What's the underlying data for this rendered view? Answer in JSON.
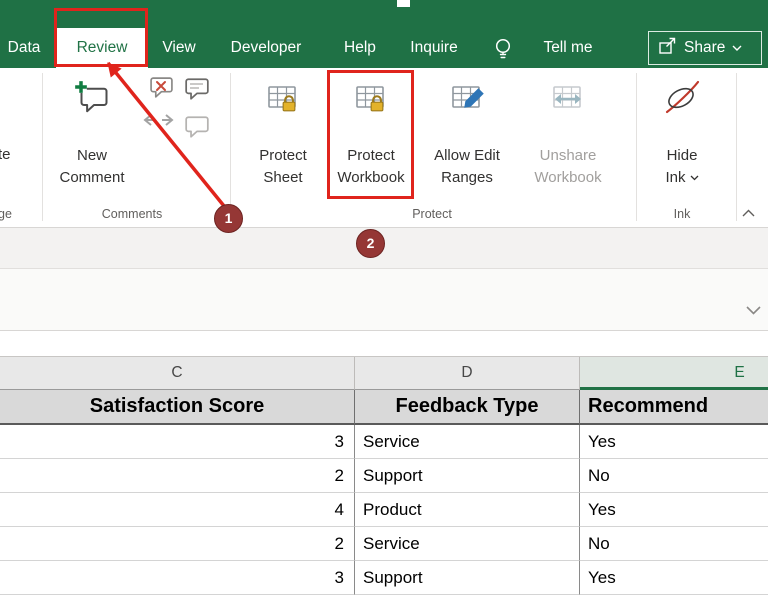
{
  "colors": {
    "excel_green": "#217346",
    "selected_tab_text": "#217346",
    "annotation_red": "#e0241c",
    "step_badge_red": "#953735",
    "table_header_fill": "#d9d9d9",
    "column_header_fill": "#e8e8e8"
  },
  "ribbon": {
    "tabs": [
      {
        "label": "Data",
        "selected": false
      },
      {
        "label": "Review",
        "selected": true
      },
      {
        "label": "View",
        "selected": false
      },
      {
        "label": "Developer",
        "selected": false
      },
      {
        "label": "Help",
        "selected": false
      },
      {
        "label": "Inquire",
        "selected": false
      }
    ],
    "tell_me_label": "Tell me",
    "share_label": "Share",
    "edge_fragments": {
      "button_text": "te",
      "group_label": "ge"
    },
    "comments_group": {
      "label": "Comments",
      "new_comment_label": "New Comment"
    },
    "protect_group": {
      "label": "Protect",
      "protect_sheet_label": "Protect Sheet",
      "protect_workbook_label": "Protect Workbook",
      "allow_edit_ranges_label": "Allow Edit Ranges",
      "unshare_workbook_label": "Unshare Workbook"
    },
    "ink_group": {
      "label": "Ink",
      "hide_ink_line1": "Hide",
      "hide_ink_line2": "Ink"
    }
  },
  "annotations": {
    "step1": "1",
    "step2": "2"
  },
  "sheet": {
    "column_headers": [
      "C",
      "D",
      "E"
    ],
    "table_header": [
      "Satisfaction Score",
      "Feedback Type",
      "Recommend"
    ],
    "rows": [
      [
        "3",
        "Service",
        "Yes"
      ],
      [
        "2",
        "Support",
        "No"
      ],
      [
        "4",
        "Product",
        "Yes"
      ],
      [
        "2",
        "Service",
        "No"
      ],
      [
        "3",
        "Support",
        "Yes"
      ]
    ]
  }
}
